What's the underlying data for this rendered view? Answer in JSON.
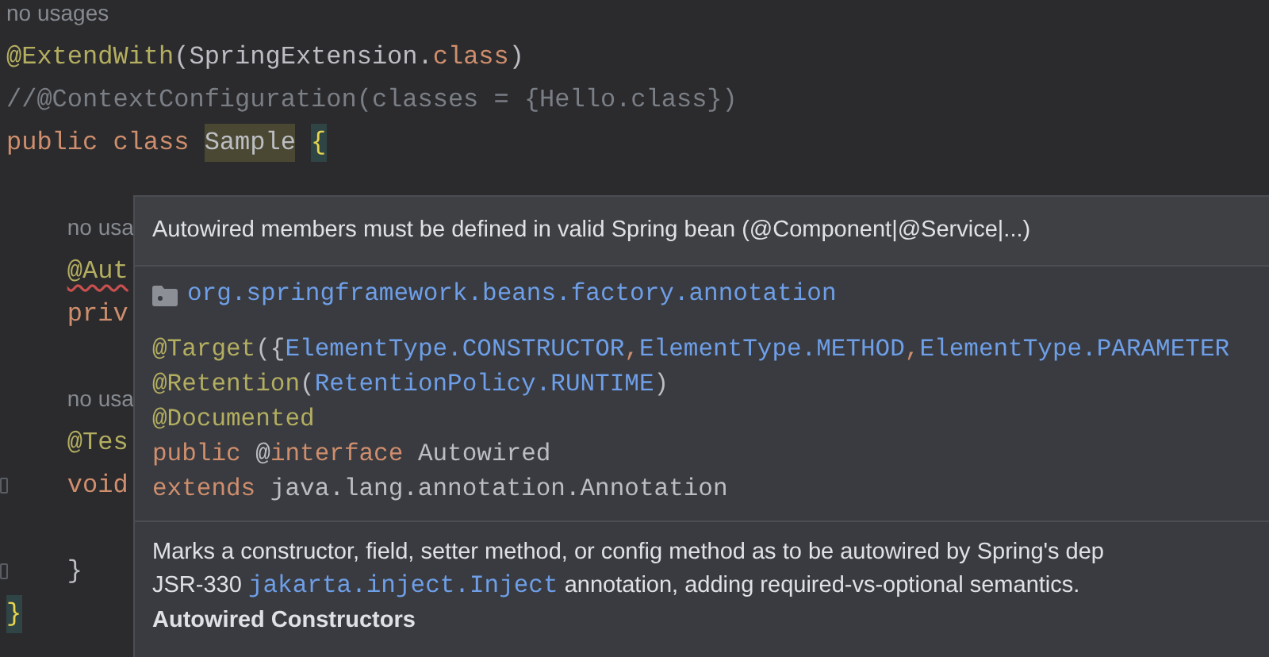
{
  "editor": {
    "lines": [
      {
        "fold_marker": false,
        "tokens": [
          {
            "kind": "hint",
            "text": "no usages"
          }
        ]
      },
      {
        "fold_marker": false,
        "tokens": [
          {
            "kind": "annotation",
            "text": "@ExtendWith"
          },
          {
            "kind": "plain",
            "text": "(SpringExtension."
          },
          {
            "kind": "keyword",
            "text": "class"
          },
          {
            "kind": "plain",
            "text": ")"
          }
        ]
      },
      {
        "fold_marker": false,
        "tokens": [
          {
            "kind": "comment",
            "text": "//@ContextConfiguration(classes = {Hello.class})"
          }
        ]
      },
      {
        "fold_marker": false,
        "tokens": [
          {
            "kind": "keyword",
            "text": "public class "
          },
          {
            "kind": "highlighted",
            "text": "Sample"
          },
          {
            "kind": "brace_match",
            "text": "{"
          }
        ],
        "children": [
          {
            "fold_marker": false
          },
          {
            "fold_marker": false,
            "tokens": [
              {
                "kind": "hint",
                "text": "no usa"
              }
            ]
          },
          {
            "fold_marker": false,
            "tokens": [
              {
                "kind": "annotation_error",
                "text": "@Aut"
              }
            ]
          },
          {
            "fold_marker": false,
            "tokens": [
              {
                "kind": "keyword",
                "text": "priv"
              }
            ]
          },
          {
            "fold_marker": false
          },
          {
            "fold_marker": false,
            "tokens": [
              {
                "kind": "hint",
                "text": "no usa"
              }
            ]
          },
          {
            "fold_marker": false,
            "tokens": [
              {
                "kind": "annotation",
                "text": "@Tes"
              }
            ]
          },
          {
            "fold_marker": true,
            "tokens": [
              {
                "kind": "keyword",
                "text": "void"
              }
            ]
          },
          {
            "fold_marker": false
          },
          {
            "fold_marker": true,
            "tokens": [
              {
                "kind": "plain",
                "text": "}"
              }
            ]
          }
        ]
      },
      {
        "fold_marker": false,
        "tokens": [
          {
            "kind": "brace_match",
            "text": "}"
          }
        ]
      }
    ]
  },
  "popup": {
    "message": "Autowired members must be defined in valid Spring bean (@Component|@Service|...)",
    "package": "org.springframework.beans.factory.annotation",
    "code": [
      [
        {
          "kind": "annotation",
          "text": "@Target"
        },
        {
          "kind": "plain",
          "text": "({"
        },
        {
          "kind": "link",
          "text": "ElementType.CONSTRUCTOR"
        },
        {
          "kind": "keyword",
          "text": ","
        },
        {
          "kind": "link",
          "text": "ElementType.METHOD"
        },
        {
          "kind": "keyword",
          "text": ","
        },
        {
          "kind": "link",
          "text": "ElementType.PARAMETER"
        }
      ],
      [
        {
          "kind": "annotation",
          "text": "@Retention"
        },
        {
          "kind": "plain",
          "text": "("
        },
        {
          "kind": "link",
          "text": "RetentionPolicy.RUNTIME"
        },
        {
          "kind": "plain",
          "text": ")"
        }
      ],
      [
        {
          "kind": "annotation",
          "text": "@Documented"
        }
      ],
      [
        {
          "kind": "keyword",
          "text": "public "
        },
        {
          "kind": "plain",
          "text": "@"
        },
        {
          "kind": "keyword",
          "text": "interface "
        },
        {
          "kind": "plain",
          "text": "Autowired"
        }
      ],
      [
        {
          "kind": "keyword",
          "text": "extends "
        },
        {
          "kind": "plain",
          "text": "java.lang.annotation.Annotation"
        }
      ]
    ],
    "description": [
      [
        {
          "kind": "text",
          "text": "Marks a constructor, field, setter method, or config method as to be autowired by Spring's dep"
        }
      ],
      [
        {
          "kind": "text",
          "text": "JSR-330 "
        },
        {
          "kind": "link",
          "text": "jakarta.inject.Inject"
        },
        {
          "kind": "text",
          "text": " annotation, adding required-vs-optional semantics."
        }
      ]
    ],
    "section_heading": "Autowired Constructors"
  }
}
